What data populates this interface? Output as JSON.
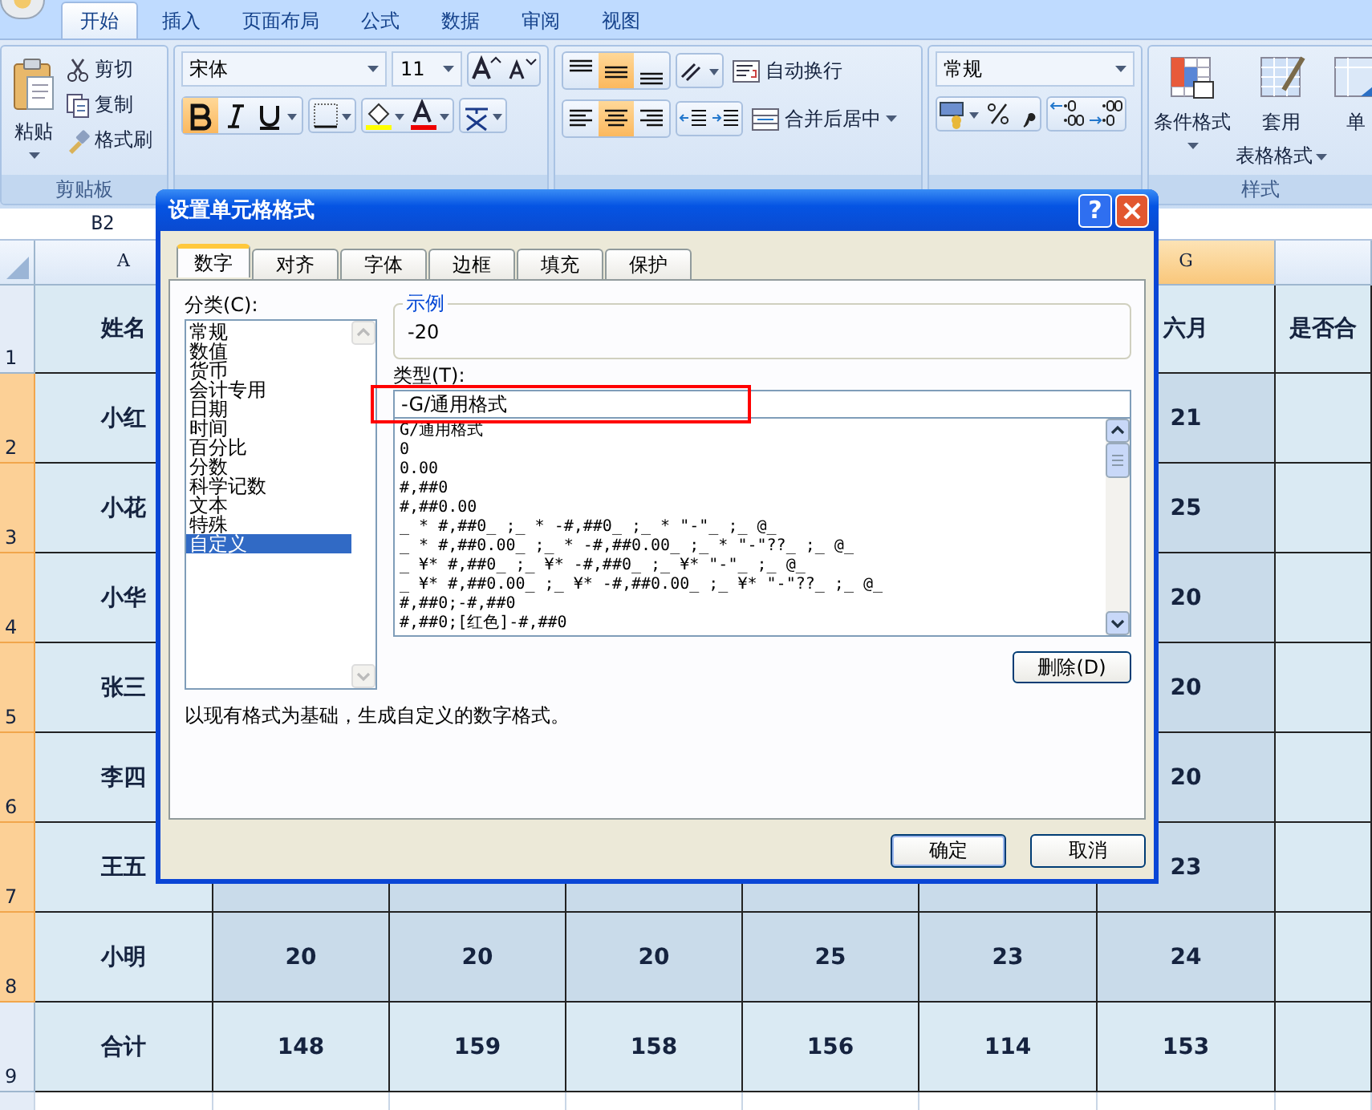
{
  "ribbon_tabs": [
    {
      "label": "开始",
      "selected": true
    },
    {
      "label": "插入",
      "selected": false
    },
    {
      "label": "页面布局",
      "selected": false
    },
    {
      "label": "公式",
      "selected": false
    },
    {
      "label": "数据",
      "selected": false
    },
    {
      "label": "审阅",
      "selected": false
    },
    {
      "label": "视图",
      "selected": false
    }
  ],
  "clipboard": {
    "paste": "粘贴",
    "items": [
      {
        "kind": "cut",
        "label": "剪切"
      },
      {
        "kind": "copy",
        "label": "复制"
      },
      {
        "kind": "painter",
        "label": "格式刷"
      }
    ],
    "group_label": "剪贴板"
  },
  "font": {
    "name": "宋体",
    "size": "11",
    "bold": true,
    "italic": false,
    "underline": false
  },
  "alignment": {
    "vertical_buttons": [
      {
        "kind": "top",
        "selected": false
      },
      {
        "kind": "middle",
        "selected": true
      },
      {
        "kind": "bottom",
        "selected": false
      }
    ],
    "horizontal_buttons": [
      {
        "kind": "left",
        "selected": false
      },
      {
        "kind": "center",
        "selected": true
      },
      {
        "kind": "right",
        "selected": false
      }
    ],
    "wrap_text": "自动换行",
    "merge_center": "合并后居中"
  },
  "number": {
    "format": "常规"
  },
  "styles": {
    "buttons": [
      {
        "kind": "conditional",
        "lines": [
          "条件格式"
        ],
        "caret": true
      },
      {
        "kind": "table",
        "lines": [
          "套用",
          "表格格式"
        ],
        "caret": true
      },
      {
        "kind": "cell",
        "lines": [
          "单"
        ],
        "caret": false
      }
    ],
    "group_label": "样式"
  },
  "name_box": "B2",
  "sheet": {
    "columns": [
      {
        "header": "A",
        "selected": false
      },
      {},
      {},
      {},
      {},
      {},
      {
        "header": "G",
        "selected": true
      },
      {
        "selected": false
      }
    ],
    "rows": [
      {
        "number": "1",
        "selected": false,
        "cells": [
          {
            "text": "姓名",
            "selected": false
          },
          {},
          {},
          {},
          {},
          {},
          {
            "text": "六月",
            "selected": false
          },
          {
            "text": "是否合",
            "selected": false
          }
        ]
      },
      {
        "number": "2",
        "selected": true,
        "cells": [
          {
            "text": "小红",
            "selected": false
          },
          {},
          {},
          {},
          {},
          {},
          {
            "text": "21",
            "selected": true
          },
          {
            "selected": false
          }
        ]
      },
      {
        "number": "3",
        "selected": true,
        "cells": [
          {
            "text": "小花",
            "selected": false
          },
          {},
          {},
          {},
          {},
          {},
          {
            "text": "25",
            "selected": true
          },
          {
            "selected": false
          }
        ]
      },
      {
        "number": "4",
        "selected": true,
        "cells": [
          {
            "text": "小华",
            "selected": false
          },
          {},
          {},
          {},
          {},
          {},
          {
            "text": "20",
            "selected": true
          },
          {
            "selected": false
          }
        ]
      },
      {
        "number": "5",
        "selected": true,
        "cells": [
          {
            "text": "张三",
            "selected": false
          },
          {},
          {},
          {},
          {},
          {},
          {
            "text": "20",
            "selected": true
          },
          {
            "selected": false
          }
        ]
      },
      {
        "number": "6",
        "selected": true,
        "cells": [
          {
            "text": "李四",
            "selected": false
          },
          {},
          {},
          {},
          {},
          {},
          {
            "text": "20",
            "selected": true
          },
          {
            "selected": false
          }
        ]
      },
      {
        "number": "7",
        "selected": true,
        "cells": [
          {
            "text": "王五",
            "selected": false
          },
          {
            "selected": true
          },
          {
            "selected": true
          },
          {
            "selected": true
          },
          {
            "selected": true
          },
          {
            "selected": true
          },
          {
            "text": "23",
            "selected": true
          },
          {
            "selected": false
          }
        ]
      },
      {
        "number": "8",
        "selected": true,
        "cells": [
          {
            "text": "小明",
            "selected": false
          },
          {
            "text": "20",
            "selected": true
          },
          {
            "text": "20",
            "selected": true
          },
          {
            "text": "20",
            "selected": true
          },
          {
            "text": "25",
            "selected": true
          },
          {
            "text": "23",
            "selected": true
          },
          {
            "text": "24",
            "selected": true
          },
          {
            "selected": false
          }
        ]
      },
      {
        "number": "9",
        "selected": false,
        "cells": [
          {
            "text": "合计",
            "selected": false
          },
          {
            "text": "148",
            "selected": false
          },
          {
            "text": "159",
            "selected": false
          },
          {
            "text": "158",
            "selected": false
          },
          {
            "text": "156",
            "selected": false
          },
          {
            "text": "114",
            "selected": false
          },
          {
            "text": "153",
            "selected": false
          },
          {
            "selected": false
          }
        ]
      }
    ]
  },
  "dialog": {
    "title": "设置单元格格式",
    "help": "?",
    "tabs": [
      {
        "label": "数字",
        "selected": true
      },
      {
        "label": "对齐",
        "selected": false
      },
      {
        "label": "字体",
        "selected": false
      },
      {
        "label": "边框",
        "selected": false
      },
      {
        "label": "填充",
        "selected": false
      },
      {
        "label": "保护",
        "selected": false
      }
    ],
    "category_label": "分类(C):",
    "categories": [
      {
        "label": "常规",
        "selected": false
      },
      {
        "label": "数值",
        "selected": false
      },
      {
        "label": "货币",
        "selected": false
      },
      {
        "label": "会计专用",
        "selected": false
      },
      {
        "label": "日期",
        "selected": false
      },
      {
        "label": "时间",
        "selected": false
      },
      {
        "label": "百分比",
        "selected": false
      },
      {
        "label": "分数",
        "selected": false
      },
      {
        "label": "科学记数",
        "selected": false
      },
      {
        "label": "文本",
        "selected": false
      },
      {
        "label": "特殊",
        "selected": false
      },
      {
        "label": "自定义",
        "selected": true
      }
    ],
    "sample_label": "示例",
    "sample": "-20",
    "type_label": "类型(T):",
    "type_value": "-G/通用格式",
    "type_highlighted": true,
    "formats": [
      "G/通用格式",
      "0",
      "0.00",
      "#,##0",
      "#,##0.00",
      "_ * #,##0_ ;_ * -#,##0_ ;_ * \"-\"_ ;_ @_",
      "_ * #,##0.00_ ;_ * -#,##0.00_ ;_ * \"-\"??_ ;_ @_",
      "_ ¥* #,##0_ ;_ ¥* -#,##0_ ;_ ¥* \"-\"_ ;_ @_",
      "_ ¥* #,##0.00_ ;_ ¥* -#,##0.00_ ;_ ¥* \"-\"??_ ;_ @_",
      "#,##0;-#,##0",
      "#,##0;[红色]-#,##0"
    ],
    "delete_button": "删除(D)",
    "description": "以现有格式为基础，生成自定义的数字格式。",
    "buttons": [
      {
        "label": "确定",
        "default": true
      },
      {
        "label": "取消",
        "default": false
      }
    ]
  }
}
